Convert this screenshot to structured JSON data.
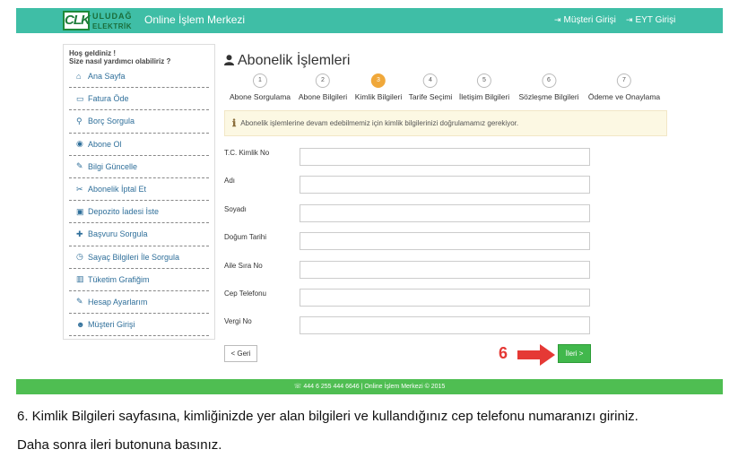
{
  "header": {
    "logo_mark": "CLK",
    "logo_line1": "ULUDAĞ",
    "logo_line2": "ELEKTRİK",
    "title": "Online İşlem Merkezi",
    "links": [
      {
        "icon": "sign-in-icon",
        "glyph": "⇥",
        "label": "Müşteri Girişi"
      },
      {
        "icon": "sign-in-icon",
        "glyph": "⇥",
        "label": "EYT Girişi"
      }
    ]
  },
  "sidebar": {
    "welcome_line1": "Hoş geldiniz !",
    "welcome_line2": "Size nasıl yardımcı olabiliriz ?",
    "items": [
      {
        "icon": "home-icon",
        "glyph": "⌂",
        "label": "Ana Sayfa"
      },
      {
        "icon": "credit-card-icon",
        "glyph": "▭",
        "label": "Fatura Öde"
      },
      {
        "icon": "search-icon",
        "glyph": "⚲",
        "label": "Borç Sorgula"
      },
      {
        "icon": "globe-icon",
        "glyph": "◉",
        "label": "Abone Ol"
      },
      {
        "icon": "edit-icon",
        "glyph": "✎",
        "label": "Bilgi Güncelle"
      },
      {
        "icon": "scissors-icon",
        "glyph": "✂",
        "label": "Abonelik İptal Et"
      },
      {
        "icon": "money-icon",
        "glyph": "▣",
        "label": "Depozito İadesi İste"
      },
      {
        "icon": "user-plus-icon",
        "glyph": "✚",
        "label": "Başvuru Sorgula"
      },
      {
        "icon": "clock-icon",
        "glyph": "◷",
        "label": "Sayaç Bilgileri İle Sorgula"
      },
      {
        "icon": "bar-chart-icon",
        "glyph": "▥",
        "label": "Tüketim Grafiğim"
      },
      {
        "icon": "edit-icon",
        "glyph": "✎",
        "label": "Hesap Ayarlarım"
      },
      {
        "icon": "users-icon",
        "glyph": "☻",
        "label": "Müşteri Girişi"
      }
    ]
  },
  "main": {
    "title": "Abonelik İşlemleri",
    "title_icon": "user-icon",
    "steps": [
      {
        "num": "1",
        "label": "Abone Sorgulama",
        "active": false
      },
      {
        "num": "2",
        "label": "Abone Bilgileri",
        "active": false
      },
      {
        "num": "3",
        "label": "Kimlik Bilgileri",
        "active": true
      },
      {
        "num": "4",
        "label": "Tarife Seçimi",
        "active": false
      },
      {
        "num": "5",
        "label": "İletişim Bilgileri",
        "active": false
      },
      {
        "num": "6",
        "label": "Sözleşme Bilgileri",
        "active": false
      },
      {
        "num": "7",
        "label": "Ödeme ve Onaylama",
        "active": false
      }
    ],
    "notice": "Abonelik işlemlerine devam edebilmemiz için kimlik bilgilerinizi doğrulamamız gerekiyor.",
    "fields": [
      {
        "label": "T.C. Kimlik No",
        "value": ""
      },
      {
        "label": "Adı",
        "value": ""
      },
      {
        "label": "Soyadı",
        "value": ""
      },
      {
        "label": "Doğum Tarihi",
        "value": ""
      },
      {
        "label": "Aile Sıra No",
        "value": ""
      },
      {
        "label": "Cep Telefonu",
        "value": ""
      },
      {
        "label": "Vergi No",
        "value": ""
      }
    ],
    "back_label": "< Geri",
    "next_label": "İleri >",
    "annotation_number": "6"
  },
  "footer": {
    "text": "☏ 444 6 255 444 6646 | Online İşlem Merkezi © 2015"
  },
  "caption": {
    "line1": "6. Kimlik Bilgileri sayfasına, kimliğinizde yer alan bilgileri ve kullandığınız cep telefonu numaranızı giriniz.",
    "line2": "Daha sonra ileri butonuna basınız."
  },
  "colors": {
    "header": "#3fbea6",
    "footer": "#4fbe52",
    "active_step": "#f0a83a",
    "next_button": "#41b84c",
    "annotation": "#e53935"
  }
}
